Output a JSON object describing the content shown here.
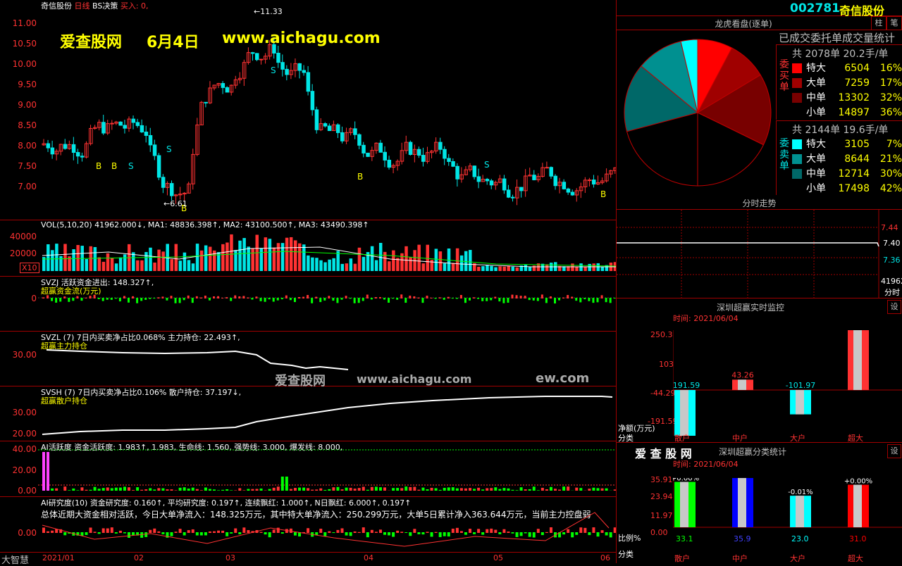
{
  "header": {
    "stock_name": "奇信股份",
    "period": "日线",
    "indicator": "BS决策",
    "buy_label": "买入: 0,",
    "code": "002781",
    "name": "奇信股份",
    "btn_zhu": "柱",
    "btn_bi": "笔"
  },
  "overlay": {
    "site": "爱查股网",
    "date": "6月4日",
    "url": "www.aichagu.com",
    "wm_cn": "爱查股网",
    "wm_url": "www.aichagu.com",
    "wm_tail": "ew.com"
  },
  "price_axis": [
    "11.00",
    "10.50",
    "10.00",
    "9.50",
    "9.00",
    "8.50",
    "8.00",
    "7.50",
    "7.00"
  ],
  "price_annotations": {
    "high": "←11.33",
    "low": "←6.61"
  },
  "vol": {
    "title": "VOL(5,10,20) 41962.000↓, MA1: 48836.398↑, MA2: 43100.500↑, MA3: 43490.398↑",
    "axis": [
      "40000",
      "20000"
    ],
    "unit": "X10"
  },
  "svzj": {
    "title": "SVZJ  活跃资金进出: 148.327↑,",
    "sub": "超赢资金流(万元)",
    "axis": "0"
  },
  "svzl": {
    "title": "SVZL (7) 7日内买卖净占比0.068% 主力持仓: 22.493↑,",
    "sub": "超赢主力持仓",
    "axis": "30.00"
  },
  "svsh": {
    "title": "SVSH (7) 7日内买卖净占比0.106% 散户持仓: 37.197↓,",
    "sub": "超赢散户持仓",
    "axis": [
      "30.00",
      "20.00"
    ]
  },
  "ai": {
    "title": "AI活跃度 资金活跃度: 1.983↑, 1.983, 生命线: 1.560, 强势线: 3.000, 爆发线: 8.000,",
    "axis": [
      "40.00",
      "20.00",
      "0.00"
    ]
  },
  "air": {
    "title": "AI研究度(10) 资金研究度: 0.160↑, 平均研究度: 0.197↑, 连续飘红: 1.000↑, N日飘红: 6.000↑, 0.197↑",
    "summary": "总体近期大资金相对活跃，今日大单净流入：148.325万元，其中特大单净流入：250.299万元，大单5日累计净入363.644万元，当前主力控盘弱",
    "axis": "0.00"
  },
  "bottom": {
    "brand": "大智慧",
    "dates": [
      "2021/01",
      "02",
      "03",
      "04",
      "05",
      "06"
    ]
  },
  "longhu": {
    "title": "龙虎看盘(逐单)",
    "subtitle": "已成交委托单成交量统计",
    "buy": {
      "side_label": "委买单",
      "total": "共 2078单 20.2手/单",
      "rows": [
        {
          "label": "特大",
          "count": "6504",
          "pct": "16%",
          "color": "#ff0000"
        },
        {
          "label": "大单",
          "count": "7259",
          "pct": "17%",
          "color": "#a00000"
        },
        {
          "label": "中单",
          "count": "13302",
          "pct": "32%",
          "color": "#780000"
        },
        {
          "label": "小单",
          "count": "14897",
          "pct": "36%",
          "color": "#000000"
        }
      ]
    },
    "sell": {
      "side_label": "委卖单",
      "total": "共 2144单 19.6手/单",
      "rows": [
        {
          "label": "特大",
          "count": "3105",
          "pct": "7%",
          "color": "#00ffff"
        },
        {
          "label": "大单",
          "count": "8644",
          "pct": "21%",
          "color": "#009090"
        },
        {
          "label": "中单",
          "count": "12714",
          "pct": "30%",
          "color": "#006868"
        },
        {
          "label": "小单",
          "count": "17498",
          "pct": "42%",
          "color": "#000000"
        }
      ]
    }
  },
  "intraday": {
    "title": "分时走势",
    "prices": [
      "7.44",
      "7.40",
      "7.36"
    ],
    "vol": "41962",
    "vol_unit": "分时"
  },
  "monitor": {
    "title": "深圳超赢实时监控",
    "setting": "设",
    "time": "时间: 2021/06/04",
    "axis": [
      "250.3",
      "103",
      "-44.29",
      "-191.59"
    ],
    "ylabel": "净额(万元)",
    "xlabel": "分类",
    "bars": [
      {
        "label": "散户",
        "value": "-191.59",
        "num": -191.59,
        "color": "#00ffff"
      },
      {
        "label": "中户",
        "value": "43.26",
        "num": 43.26,
        "color": "#ff3232"
      },
      {
        "label": "大户",
        "value": "-101.97",
        "num": -101.97,
        "color": "#00ffff"
      },
      {
        "label": "超大",
        "value": "250.3",
        "num": 250.3,
        "color": "#ff3232"
      }
    ]
  },
  "classify": {
    "logo": "爱 查 股 网",
    "title": "深圳超赢分类统计",
    "setting": "设",
    "time": "时间: 2021/06/04",
    "axis": [
      "35.91",
      "23.94",
      "11.97",
      "0.00"
    ],
    "ylabel": "比例%",
    "xlabel": "分类",
    "bars": [
      {
        "label": "散户",
        "value": "33.1",
        "change": "+0.00%",
        "num": 33.1,
        "color": "#00ff00"
      },
      {
        "label": "中户",
        "value": "35.9",
        "change": "-0.00%",
        "num": 35.9,
        "color": "#0000ff"
      },
      {
        "label": "大户",
        "value": "23.0",
        "change": "-0.01%",
        "num": 23.0,
        "color": "#00ffff"
      },
      {
        "label": "超大",
        "value": "31.0",
        "change": "+0.00%",
        "num": 31.0,
        "color": "#ff0000"
      }
    ]
  },
  "colors": {
    "up": "#ff3232",
    "down": "#00e6e6",
    "grid": "#a00000"
  }
}
